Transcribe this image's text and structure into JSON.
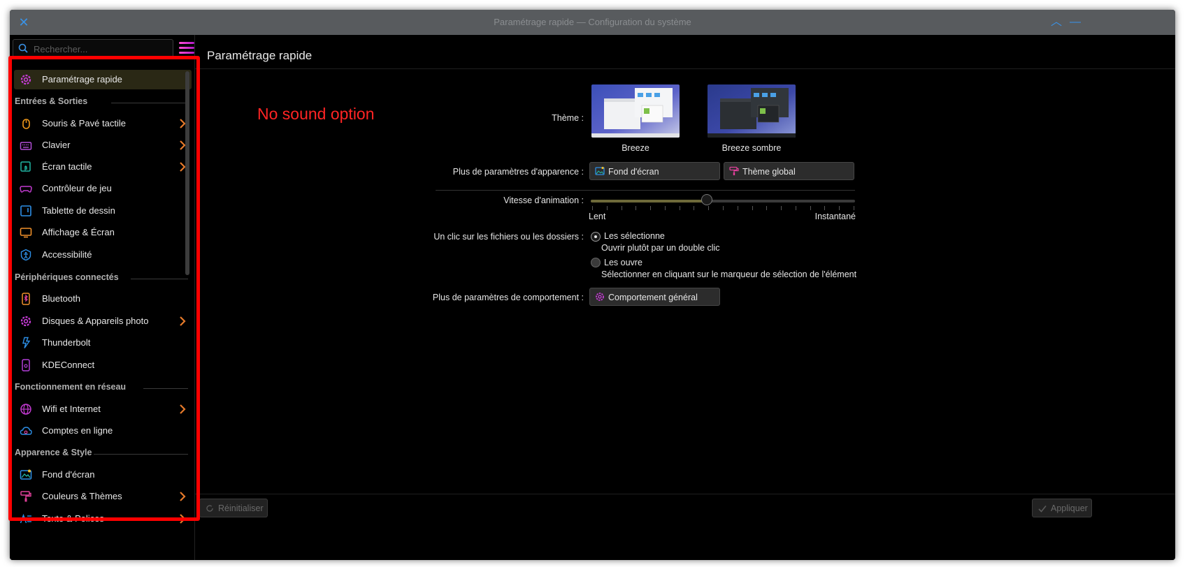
{
  "window": {
    "title": "Paramétrage rapide — Configuration du système"
  },
  "search": {
    "placeholder": "Rechercher..."
  },
  "sidebar": {
    "items": [
      {
        "label": "Paramétrage rapide"
      },
      {
        "section": "Entrées & Sorties"
      },
      {
        "label": "Souris & Pavé tactile"
      },
      {
        "label": "Clavier"
      },
      {
        "label": "Écran tactile"
      },
      {
        "label": "Contrôleur de jeu"
      },
      {
        "label": "Tablette de dessin"
      },
      {
        "label": "Affichage & Écran"
      },
      {
        "label": "Accessibilité"
      },
      {
        "section": "Périphériques connectés"
      },
      {
        "label": "Bluetooth"
      },
      {
        "label": "Disques & Appareils photo"
      },
      {
        "label": "Thunderbolt"
      },
      {
        "label": "KDEConnect"
      },
      {
        "section": "Fonctionnement en réseau"
      },
      {
        "label": "Wifi et Internet"
      },
      {
        "label": "Comptes en ligne"
      },
      {
        "section": "Apparence & Style"
      },
      {
        "label": "Fond d'écran"
      },
      {
        "label": "Couleurs & Thèmes"
      },
      {
        "label": "Texte & Polices"
      }
    ]
  },
  "content": {
    "page_title": "Paramétrage rapide",
    "annotation": "No sound option",
    "theme_label": "Thème :",
    "themes": [
      {
        "name": "Breeze"
      },
      {
        "name": "Breeze sombre"
      }
    ],
    "appearance_label": "Plus de paramètres d'apparence :",
    "wallpaper_button": "Fond d'écran",
    "global_theme_button": "Thème global",
    "animation_label": "Vitesse d'animation :",
    "animation_min": "Lent",
    "animation_max": "Instantané",
    "animation_value": 0.44,
    "click_label": "Un clic sur les fichiers ou les dossiers :",
    "click_select": "Les sélectionne",
    "click_select_hint": "Ouvrir plutôt par un double clic",
    "click_open": "Les ouvre",
    "click_open_hint": "Sélectionner en cliquant sur le marqueur de sélection de l'élément",
    "behavior_label": "Plus de paramètres de comportement :",
    "behavior_button": "Comportement général"
  },
  "footer": {
    "reset": "Réinitialiser",
    "apply": "Appliquer"
  },
  "colors": {
    "accent": "#3a92e6",
    "active_item_bg": "#2a2815",
    "annotation_red": "#ff0000"
  }
}
